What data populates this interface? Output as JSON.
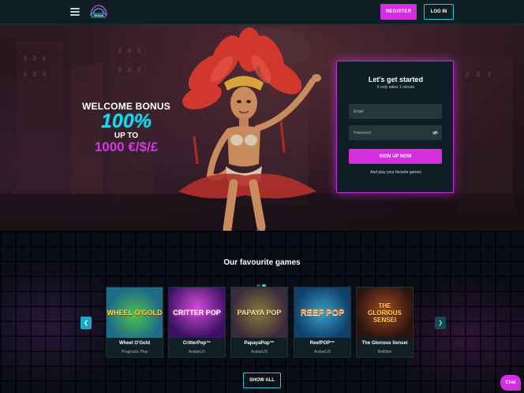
{
  "header": {
    "register_label": "REGISTER",
    "login_label": "LOG IN",
    "logo_icon": "vegas-logo-icon",
    "menu_icon": "hamburger-menu-icon"
  },
  "hero": {
    "bonus": {
      "line1": "WELCOME BONUS",
      "percent": "100%",
      "upto": "UP TO",
      "amount": "1000 €/$/£"
    },
    "signup": {
      "title": "Let's get started",
      "subtitle": "It only takes 1 minute",
      "email_placeholder": "Email",
      "password_placeholder": "Password",
      "button_label": "SIGN UP NOW",
      "note": "And play your favorite games"
    }
  },
  "games": {
    "title": "Our favourite games",
    "items": [
      {
        "name": "Wheel O'Gold",
        "provider": "Pragmatic Play",
        "art_text": "WHEEL O'GOLD"
      },
      {
        "name": "CritterPop™",
        "provider": "AvatarUX",
        "art_text": "CRITTER POP"
      },
      {
        "name": "PapayaPop™",
        "provider": "AvatarUX",
        "art_text": "PAPAYA POP"
      },
      {
        "name": "ReefPOP™",
        "provider": "AvatarUX",
        "art_text": "REEF POP"
      },
      {
        "name": "The Glorious Sensei",
        "provider": "Betillion",
        "art_text": "THE GLORIOUS SENSEI"
      }
    ],
    "show_all_label": "SHOW ALL"
  },
  "chat_label": "Chat",
  "colors": {
    "accent_pink": "#d42ee0",
    "accent_cyan": "#2ec7d8",
    "header_bg": "#0e1f24"
  }
}
